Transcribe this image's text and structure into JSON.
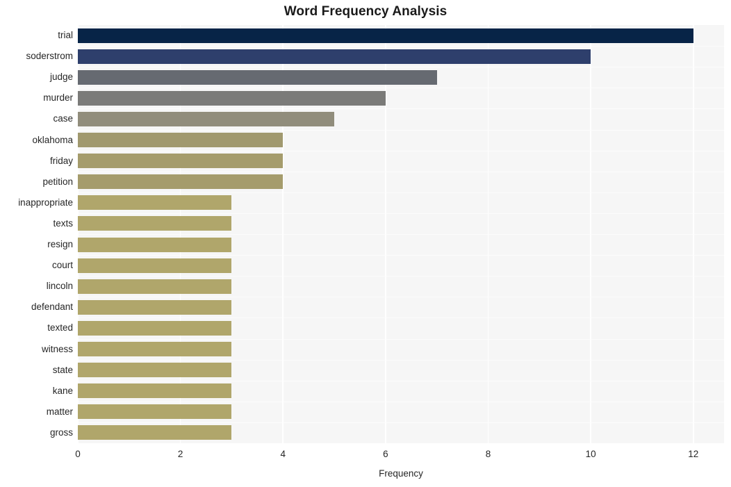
{
  "chart_data": {
    "type": "bar",
    "orientation": "horizontal",
    "title": "Word Frequency Analysis",
    "xlabel": "Frequency",
    "ylabel": "",
    "xlim": [
      0,
      12.6
    ],
    "xticks": [
      0,
      2,
      4,
      6,
      8,
      10,
      12
    ],
    "xtick_labels": [
      "0",
      "2",
      "4",
      "6",
      "8",
      "10",
      "12"
    ],
    "grid": "vertical-white-on-gray",
    "legend": "none",
    "categories": [
      "trial",
      "soderstrom",
      "judge",
      "murder",
      "case",
      "oklahoma",
      "friday",
      "petition",
      "inappropriate",
      "texts",
      "resign",
      "court",
      "lincoln",
      "defendant",
      "texted",
      "witness",
      "state",
      "kane",
      "matter",
      "gross"
    ],
    "values": [
      12,
      10,
      7,
      6,
      5,
      4,
      4,
      4,
      3,
      3,
      3,
      3,
      3,
      3,
      3,
      3,
      3,
      3,
      3,
      3
    ],
    "bar_colors": [
      "#072447",
      "#2e3f6c",
      "#666a71",
      "#7b7b79",
      "#918d7c",
      "#a1996f",
      "#a59c6c",
      "#a59c6c",
      "#b0a66b",
      "#b0a66b",
      "#b0a66b",
      "#b0a66b",
      "#b0a66b",
      "#b0a66b",
      "#b0a66b",
      "#b0a66b",
      "#b0a66b",
      "#b0a66b",
      "#b0a66b",
      "#b0a66b"
    ],
    "plot_background": "#f6f6f6",
    "figure_background": "#ffffff",
    "text_color": "#262626"
  }
}
